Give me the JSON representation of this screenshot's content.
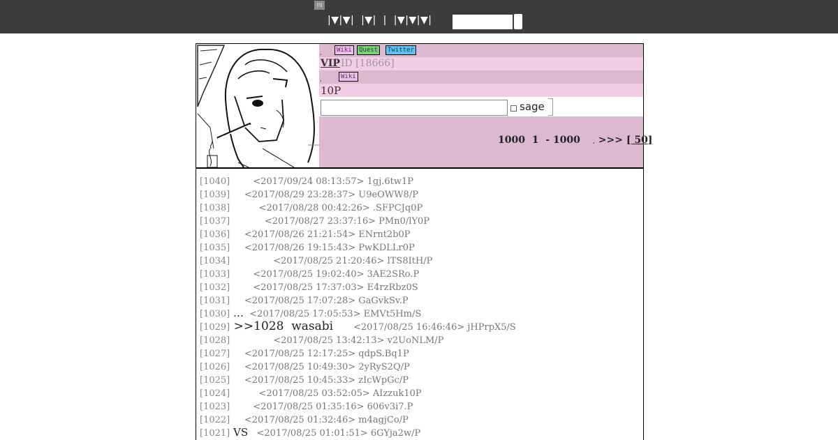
{
  "topbar": {
    "icon_label": "IN",
    "nav": "|▼|▼|  |▼|  |  |▼|▼|▼|",
    "search_value": ""
  },
  "header": {
    "tags1": [
      "Wiki",
      "Quest",
      "Twitter"
    ],
    "vip": "VIP",
    "id_text": "ID [18666]",
    "tags2": [
      "Wiki"
    ],
    "tenp": "10P",
    "sage": "sage",
    "count": "1000  1  - 1000",
    "next": ">>>",
    "next_link": "[ 50]",
    "comma": ","
  },
  "posts": [
    {
      "num": "[1040]",
      "msg": "",
      "ts": "<2017/09/24 08:13:57> 1gj.6tw1P",
      "indent": "        "
    },
    {
      "num": "[1039]",
      "msg": "",
      "ts": "<2017/08/29 23:28:37> U9eOWW8/P",
      "indent": "     "
    },
    {
      "num": "[1038]",
      "msg": "",
      "ts": "<2017/08/28 00:42:26> .SFPCJq0P",
      "indent": "          "
    },
    {
      "num": "[1037]",
      "msg": "",
      "ts": "<2017/08/27 23:37:16> PMn0/lY0P",
      "indent": "            "
    },
    {
      "num": "[1036]",
      "msg": "",
      "ts": "<2017/08/26 21:21:54> ENrnt2b0P",
      "indent": "     "
    },
    {
      "num": "[1035]",
      "msg": "",
      "ts": "<2017/08/26 19:15:43> PwKDLLr0P",
      "indent": "     "
    },
    {
      "num": "[1034]",
      "msg": "",
      "ts": "<2017/08/25 21:20:46> lTS8ItH/P",
      "indent": "               "
    },
    {
      "num": "[1033]",
      "msg": "",
      "ts": "<2017/08/25 19:02:40> 3AE2SRo.P",
      "indent": "        "
    },
    {
      "num": "[1032]",
      "msg": "",
      "ts": "<2017/08/25 17:37:03> E4rzRbz0S",
      "indent": "        "
    },
    {
      "num": "[1031]",
      "msg": "",
      "ts": "<2017/08/25 17:07:28> GaGvkSv.P",
      "indent": "     "
    },
    {
      "num": "[1030]",
      "msg": " …",
      "ts": "<2017/08/25 17:05:53> EMVt5Hm/S",
      "indent": "  "
    },
    {
      "num": "[1029]",
      "msg": " >>1028  wasabi",
      "ts": "<2017/08/25 16:46:46> jHPrpX5/S",
      "indent": "       ",
      "big": true
    },
    {
      "num": "[1028]",
      "msg": "",
      "ts": "<2017/08/25 13:42:13> v2UoNLM/P",
      "indent": "               "
    },
    {
      "num": "[1027]",
      "msg": "",
      "ts": "<2017/08/25 12:17:25> qdpS.Bq1P",
      "indent": "     "
    },
    {
      "num": "[1026]",
      "msg": "",
      "ts": "<2017/08/25 10:49:30> 2yRyS2Q/P",
      "indent": "     "
    },
    {
      "num": "[1025]",
      "msg": "",
      "ts": "<2017/08/25 10:45:33> zIcWpGc/P",
      "indent": "     "
    },
    {
      "num": "[1024]",
      "msg": "",
      "ts": "<2017/08/25 03:52:05> AIzzuk10P",
      "indent": "          "
    },
    {
      "num": "[1023]",
      "msg": "",
      "ts": "<2017/08/25 01:35:16> 606v3i7.P",
      "indent": "        "
    },
    {
      "num": "[1022]",
      "msg": "",
      "ts": "<2017/08/25 01:32:46> m4agjCo/P",
      "indent": "     "
    },
    {
      "num": "[1021]",
      "msg": " VS",
      "ts": "<2017/08/25 01:01:51> 6GYja2w/P",
      "indent": "   "
    }
  ]
}
